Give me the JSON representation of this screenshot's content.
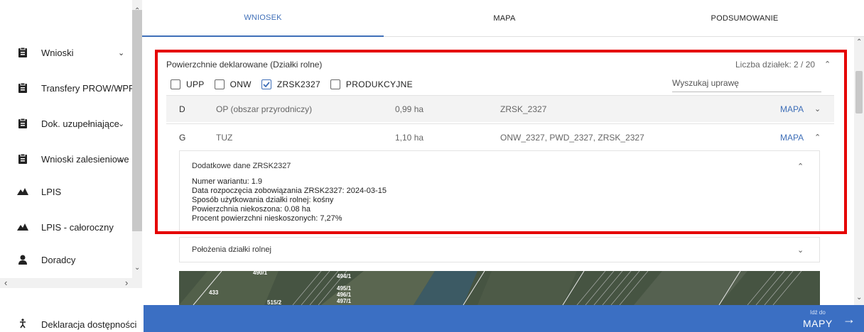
{
  "sidebar": {
    "items": [
      {
        "label": "Wnioski",
        "icon": "clipboard-icon",
        "chevron": "⌄"
      },
      {
        "label": "Transfery PROW/WPR",
        "icon": "clipboard-icon",
        "chevron": "›"
      },
      {
        "label": "Dok. uzupełniające",
        "icon": "clipboard-icon",
        "chevron": "⌄"
      },
      {
        "label": "Wnioski zalesieniowe",
        "icon": "clipboard-icon",
        "chevron": "⌄"
      },
      {
        "label": "LPIS",
        "icon": "landscape-icon",
        "chevron": ""
      },
      {
        "label": "LPIS - całoroczny",
        "icon": "landscape-icon",
        "chevron": ""
      },
      {
        "label": "Doradcy",
        "icon": "person-icon",
        "chevron": ""
      }
    ],
    "footer_label": "Deklaracja dostępności"
  },
  "tabs": [
    {
      "label": "WNIOSEK",
      "active": true
    },
    {
      "label": "MAPA",
      "active": false
    },
    {
      "label": "PODSUMOWANIE",
      "active": false
    }
  ],
  "panel": {
    "title": "Powierzchnie deklarowane (Działki rolne)",
    "count": "Liczba działek: 2 / 20",
    "filters": [
      {
        "label": "UPP",
        "checked": false
      },
      {
        "label": "ONW",
        "checked": false
      },
      {
        "label": "ZRSK2327",
        "checked": true
      },
      {
        "label": "PRODUKCYJNE",
        "checked": false
      }
    ],
    "search_placeholder": "Wyszukaj uprawę",
    "rows": [
      {
        "letter": "D",
        "name": "OP (obszar przyrodniczy)",
        "area": "0,99 ha",
        "codes": "ZRSK_2327",
        "link": "MAPA"
      },
      {
        "letter": "G",
        "name": "TUZ",
        "area": "1,10 ha",
        "codes": "ONW_2327, PWD_2327, ZRSK_2327",
        "link": "MAPA"
      }
    ],
    "detail": {
      "title": "Dodatkowe dane ZRSK2327",
      "lines": [
        "Numer wariantu: 1.9",
        "Data rozpoczęcia zobowiązania ZRSK2327: 2024-03-15",
        "Sposób użytkowania działki rolnej: kośny",
        "Powierzchnia niekoszona: 0.08 ha",
        "Procent powierzchni nieskoszonych: 7,27%"
      ]
    },
    "location_label": "Położenia działki rolnej"
  },
  "map_labels": [
    "433",
    "494/1",
    "495/1",
    "496/1",
    "497/1",
    "490/1",
    "515/2"
  ],
  "bottom": {
    "small": "Idź do",
    "big": "MAPY",
    "arrow": "→"
  },
  "colors": {
    "accent": "#3f6fb8",
    "highlight": "#e50000",
    "bar": "#3b6fc3"
  }
}
